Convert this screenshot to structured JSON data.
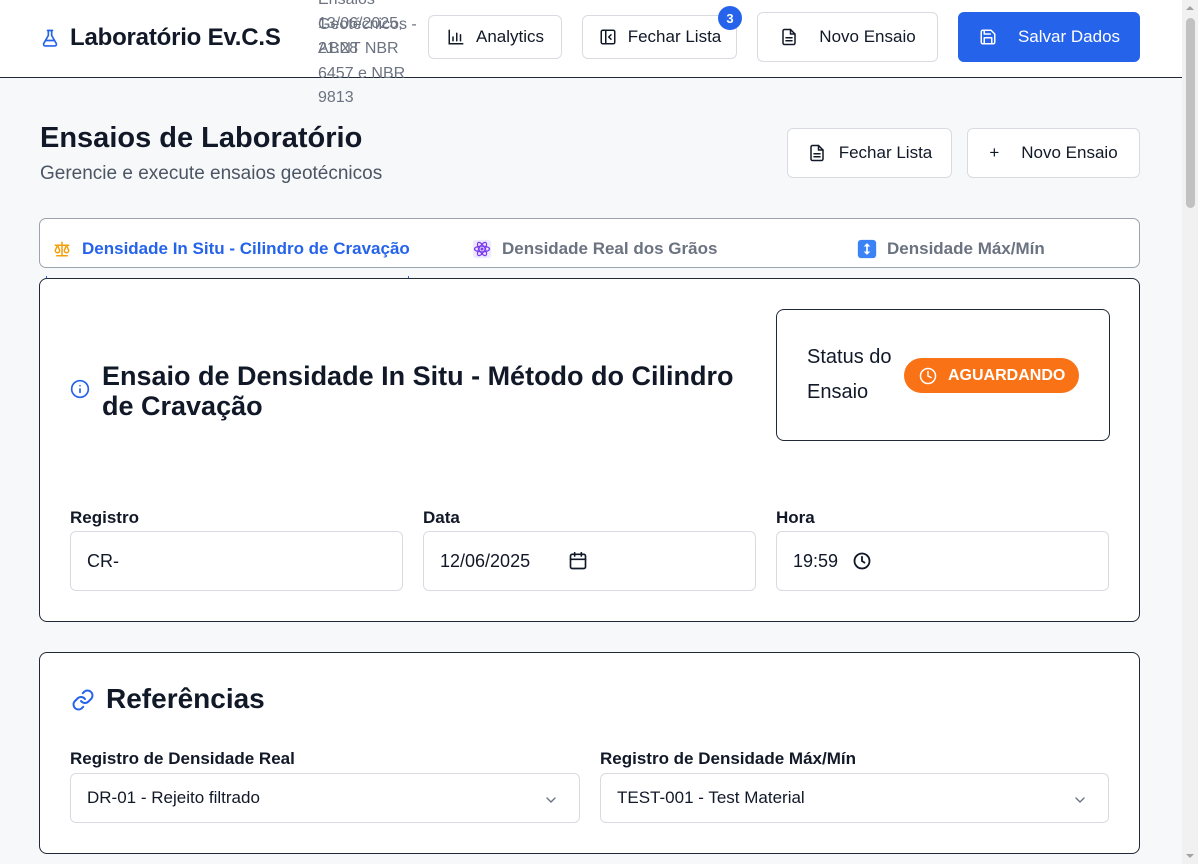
{
  "header": {
    "brand": "Laboratório Ev.C.S",
    "subtitle_text_a": "Ensaios Geotécnicos - ABNT NBR 6457 e NBR 9813",
    "subtitle_text_b": "13/06/2025, 21:28",
    "buttons": {
      "analytics": "Analytics",
      "close_list": "Fechar Lista",
      "close_list_badge": "3",
      "new_test": "Novo Ensaio",
      "save": "Salvar Dados"
    }
  },
  "page": {
    "title": "Ensaios de Laboratório",
    "subtitle": "Gerencie e execute ensaios geotécnicos",
    "actions": {
      "close_list": "Fechar Lista",
      "new_test_plus": "+",
      "new_test": "Novo Ensaio"
    }
  },
  "tabs": [
    {
      "label": "Densidade In Situ - Cilindro de Cravação",
      "icon": "scale-icon",
      "active": true
    },
    {
      "label": "Densidade Real dos Grãos",
      "icon": "atom-icon",
      "active": false
    },
    {
      "label": "Densidade Máx/Mín",
      "icon": "up-down-arrow-icon",
      "active": false
    }
  ],
  "test": {
    "title": "Ensaio de Densidade In Situ - Método do Cilindro de Cravação",
    "status_label": "Status do Ensaio",
    "status_value": "AGUARDANDO",
    "fields": {
      "registro_label": "Registro",
      "registro_value": "CR-",
      "data_label": "Data",
      "data_value": "12/06/2025",
      "hora_label": "Hora",
      "hora_value": "19:59"
    }
  },
  "references": {
    "title": "Referências",
    "real_label": "Registro de Densidade Real",
    "real_value": "DR-01 - Rejeito filtrado",
    "maxmin_label": "Registro de Densidade Máx/Mín",
    "maxmin_value": "TEST-001 - Test Material"
  },
  "colors": {
    "primary": "#2563eb",
    "status_orange": "#f97316",
    "border_dark": "#1f2937",
    "muted_text": "#6b7280"
  }
}
